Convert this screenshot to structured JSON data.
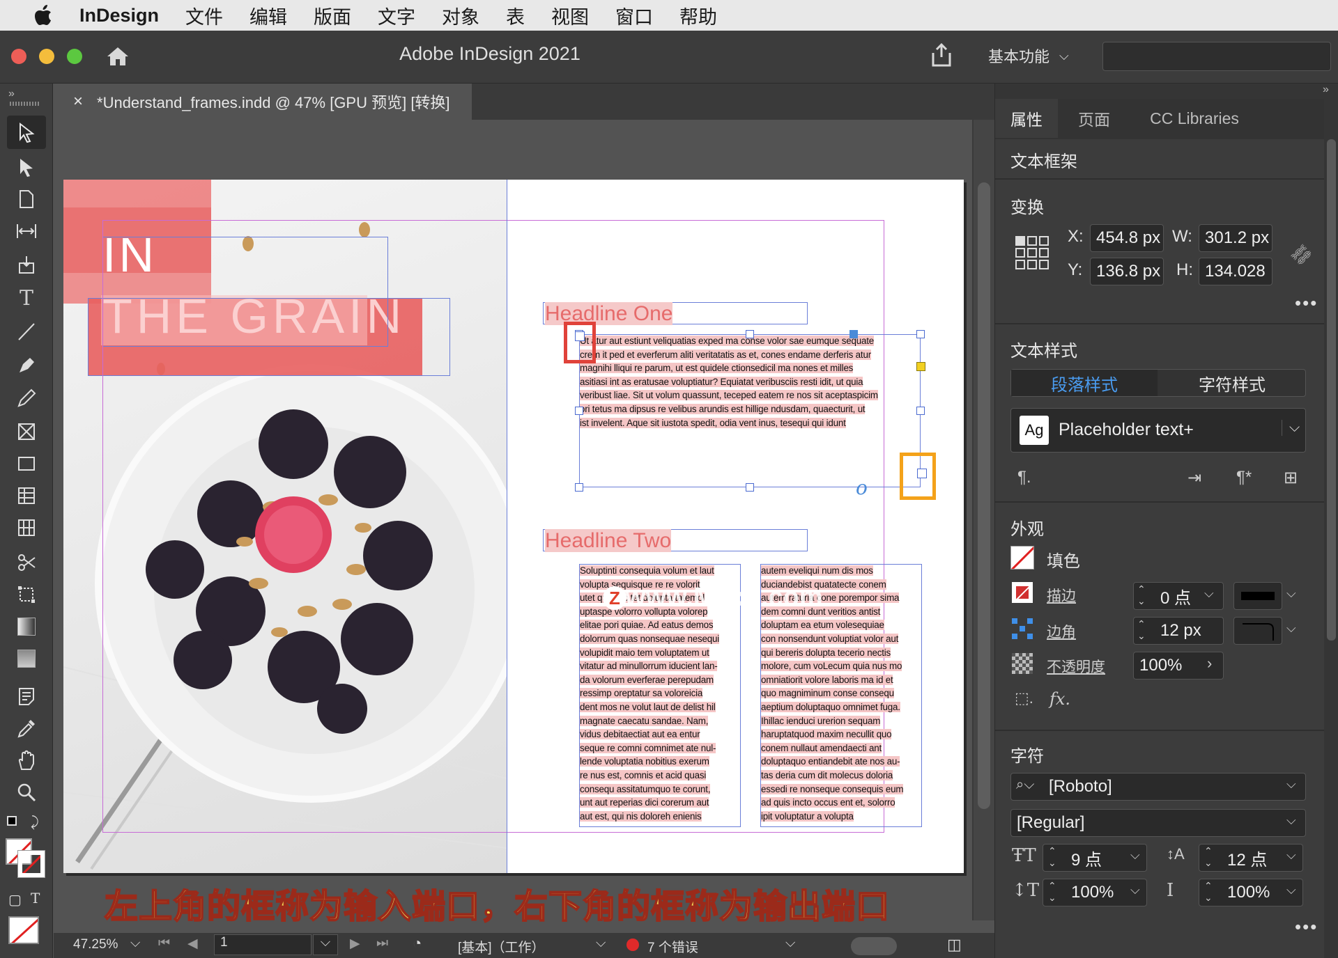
{
  "menubar": {
    "app_name": "InDesign",
    "items": [
      "文件",
      "编辑",
      "版面",
      "文字",
      "对象",
      "表",
      "视图",
      "窗口",
      "帮助"
    ]
  },
  "titlebar": {
    "title": "Adobe InDesign 2021",
    "workspace": "基本功能"
  },
  "document_tab": {
    "close": "×",
    "title": "*Understand_frames.indd @ 47% [GPU 预览] [转换]"
  },
  "page": {
    "cover_word1": "IN",
    "cover_word2": "THE GRAIN",
    "headline_one": "Headline One",
    "headline_two": "Headline Two",
    "body_main_lines": [
      "Ut   atur aut estiunt veliquatias exped ma conse volor sae eumque sequate",
      "crem   it ped et everferum aliti veritatatis as et, cones endame derferis atur",
      "magnihi lliqui re parum, ut est quidele ctionsedicil ma nones et milles",
      "asitiasi int as eratusae voluptiatur? Equiatat veribusciis resti idit, ut quia",
      "veribust liae. Sit ut volum quassunt, teceped eatem re nos sit aceptaspicim",
      "ori tetus ma dipsus re velibus arundis est hillige ndusdam, quaecturit, ut",
      "ist invelent. Aque sit iustota spedit, odia vent inus, tesequi qui idunt"
    ],
    "col_left_lines": [
      "Soluptinti consequia volum et laut",
      "volupta sequisque re re volorit",
      "utet qui offic tet dolupta tatemol",
      "uptaspe volorro vollupta volorep",
      "elitae pori quiae. Ad eatus demos",
      "dolorrum quas nonsequae nesequi",
      "volupidit maio tem voluptatem ut",
      "vitatur ad minullorrum iducient lan-",
      "da volorum everferae perepudam",
      "ressimp oreptatur sa voloreicia",
      "dent mos ne volut laut de delist hil",
      "magnate caecatu sandae. Nam,",
      "vidus debitaectiat aut ea entur",
      "seque re comni comnimet ate nul-",
      "lende voluptatia nobitius exerum",
      "re nus est, comnis et acid quasi",
      "consequ assitatumquo te corunt,",
      "unt aut reperias dici corerum aut",
      "aut est, qui nis doloreh enienis"
    ],
    "col_right_lines": [
      "autem eveliqui num dis mos",
      "duciandebist quatatecte conem",
      "autem raturia cone porempor sima",
      "dem comni dunt veritios antist",
      "doluptam ea etum volesequiae",
      "con nonsendunt voluptiat volor aut",
      "qui bereris dolupta tecerio nectis",
      "molore, cum voLecum quia nus mo",
      "omniatiorit volore laboris ma id et",
      "quo magniminum conse consequ",
      "aeptium doluptaquo omnimet fuga.",
      "Ihillac ienduci urerion sequam",
      "haruptatquod maxim necullit quo",
      "conem nullaut amendaecti ant",
      "doluptaquo entiandebit ate nos au-",
      "tas deria cum dit molecus doloria",
      "essedi re nonseque consequis eum",
      "ad quis incto occus ent et, solorro",
      "ipit voluptatur a volupta"
    ],
    "watermark": "www.MacZ.com",
    "watermark_logo": "Z"
  },
  "subtitle": "左上角的框称为输入端口，右下角的框称为输出端口",
  "status": {
    "zoom": "47.25%",
    "page_number": "1",
    "style": "[基本]（工作）",
    "errors": "7 个错误"
  },
  "right_panel": {
    "tabs": [
      "属性",
      "页面",
      "CC Libraries"
    ],
    "object_type": "文本框架",
    "transform": {
      "title": "变换",
      "x_label": "X:",
      "x": "454.8 px",
      "y_label": "Y:",
      "y": "136.8 px",
      "w_label": "W:",
      "w": "301.2 px",
      "h_label": "H:",
      "h": "134.028"
    },
    "text_style": {
      "title": "文本样式",
      "tab_paragraph": "段落样式",
      "tab_character": "字符样式",
      "style_icon": "Ag",
      "style_name": "Placeholder text+"
    },
    "appearance": {
      "title": "外观",
      "fill": "填色",
      "stroke": "描边",
      "stroke_value": "0 点",
      "corner": "边角",
      "corner_value": "12 px",
      "opacity": "不透明度",
      "opacity_value": "100%",
      "fx": "fx."
    },
    "character": {
      "title": "字符",
      "font": "[Roboto]",
      "style": "[Regular]",
      "size": "9 点",
      "leading": "12 点",
      "vscale": "100%",
      "hscale": "100%"
    }
  },
  "colors": {
    "accent_blue": "#4a8bd8",
    "overset_red": "#e03a3a",
    "callout_orange": "#f4a21a",
    "highlight_pink": "#f5c6c6",
    "headline_red": "#e66b6b"
  }
}
